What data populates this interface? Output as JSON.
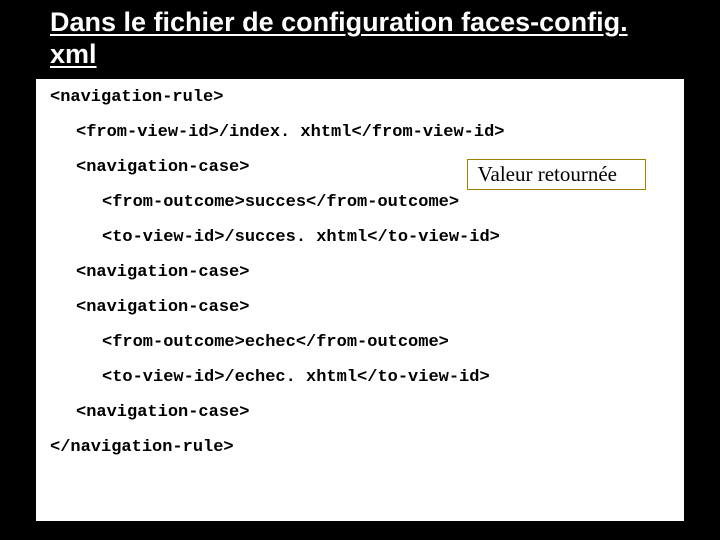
{
  "title": "Dans le fichier de configuration faces-config. xml",
  "callout": "Valeur retournée",
  "code": {
    "l0": "<navigation-rule>",
    "l1": "<from-view-id>/index. xhtml</from-view-id>",
    "l2": "<navigation-case>",
    "l3": "<from-outcome>succes</from-outcome>",
    "l4": "<to-view-id>/succes. xhtml</to-view-id>",
    "l5": "<navigation-case>",
    "l6": "<navigation-case>",
    "l7": "<from-outcome>echec</from-outcome>",
    "l8": "<to-view-id>/echec. xhtml</to-view-id>",
    "l9": "<navigation-case>",
    "l10": "</navigation-rule>"
  }
}
